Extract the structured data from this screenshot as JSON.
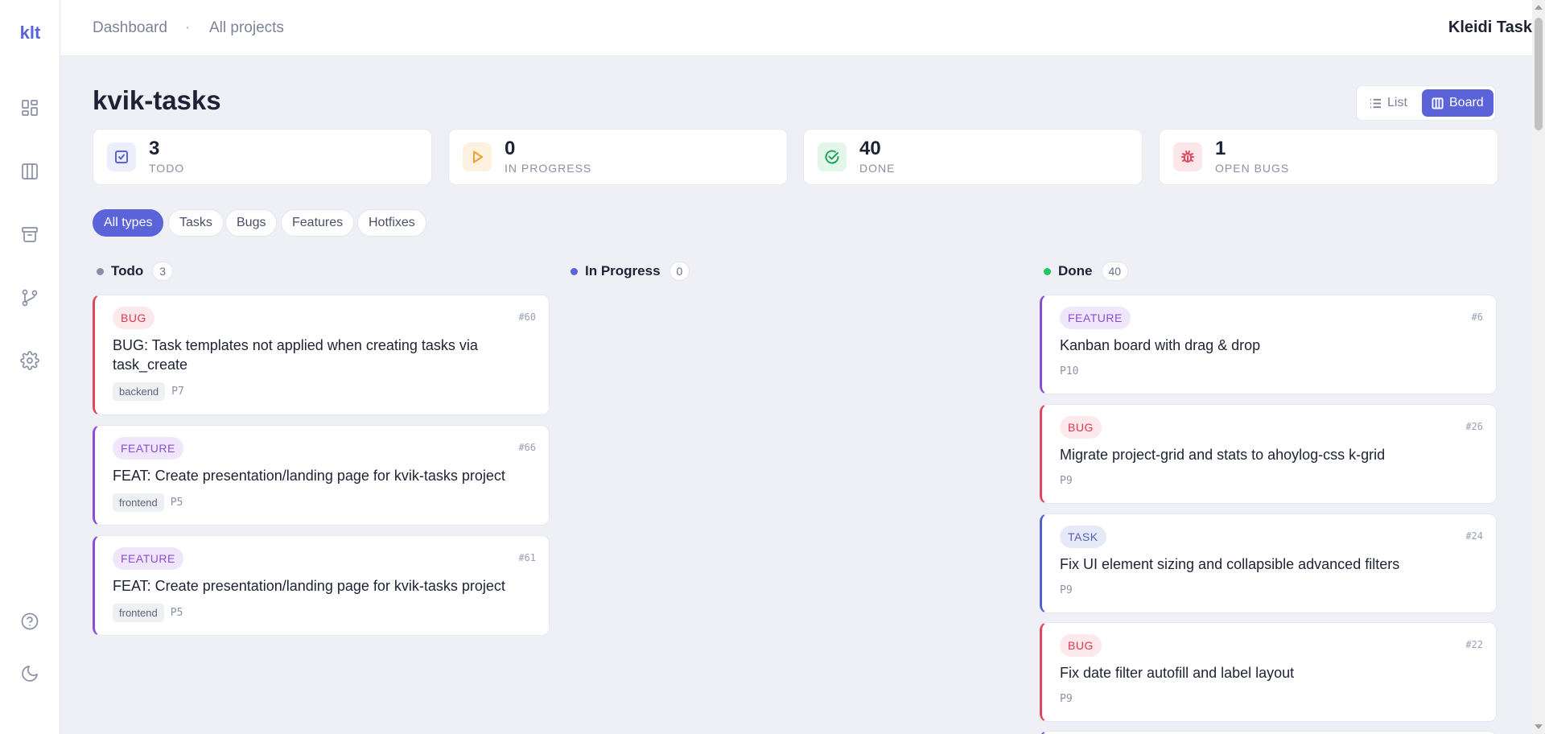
{
  "app": {
    "logo": "klt",
    "brand": "Kleidi Task"
  },
  "breadcrumb": {
    "dashboard": "Dashboard",
    "separator": "·",
    "all_projects": "All projects"
  },
  "project": {
    "title": "kvik-tasks"
  },
  "view_toggle": {
    "list": "List",
    "board": "Board",
    "active": "Board"
  },
  "stats": [
    {
      "value": "3",
      "label": "TODO",
      "icon": "checkbox-icon",
      "color": "#5b63d9"
    },
    {
      "value": "0",
      "label": "IN PROGRESS",
      "icon": "play-icon",
      "color": "#f0a030"
    },
    {
      "value": "40",
      "label": "DONE",
      "icon": "check-circle-icon",
      "color": "#22a35a"
    },
    {
      "value": "1",
      "label": "OPEN BUGS",
      "icon": "bug-icon",
      "color": "#e0485f"
    }
  ],
  "filters": [
    "All types",
    "Tasks",
    "Bugs",
    "Features",
    "Hotfixes"
  ],
  "active_filter": "All types",
  "columns": {
    "todo": {
      "title": "Todo",
      "count": "3",
      "color": "#8a8fa5"
    },
    "in_progress": {
      "title": "In Progress",
      "count": "0",
      "color": "#5b63d9"
    },
    "done": {
      "title": "Done",
      "count": "40",
      "color": "#22c55e"
    }
  },
  "todo_cards": [
    {
      "type": "BUG",
      "id": "#60",
      "title": "BUG: Task templates not applied when creating tasks via task_create",
      "tag": "backend",
      "priority": "P7"
    },
    {
      "type": "FEATURE",
      "id": "#66",
      "title": "FEAT: Create presentation/landing page for kvik-tasks project",
      "tag": "frontend",
      "priority": "P5"
    },
    {
      "type": "FEATURE",
      "id": "#61",
      "title": "FEAT: Create presentation/landing page for kvik-tasks project",
      "tag": "frontend",
      "priority": "P5"
    }
  ],
  "done_cards": [
    {
      "type": "FEATURE",
      "id": "#6",
      "title": "Kanban board with drag & drop",
      "priority": "P10"
    },
    {
      "type": "BUG",
      "id": "#26",
      "title": "Migrate project-grid and stats to ahoylog-css k-grid",
      "priority": "P9"
    },
    {
      "type": "TASK",
      "id": "#24",
      "title": "Fix UI element sizing and collapsible advanced filters",
      "priority": "P9"
    },
    {
      "type": "BUG",
      "id": "#22",
      "title": "Fix date filter autofill and label layout",
      "priority": "P9"
    }
  ],
  "sidebar_icons": [
    "dashboard-icon",
    "board-icon",
    "archive-icon",
    "git-branch-icon",
    "settings-icon",
    "help-icon",
    "moon-icon"
  ]
}
